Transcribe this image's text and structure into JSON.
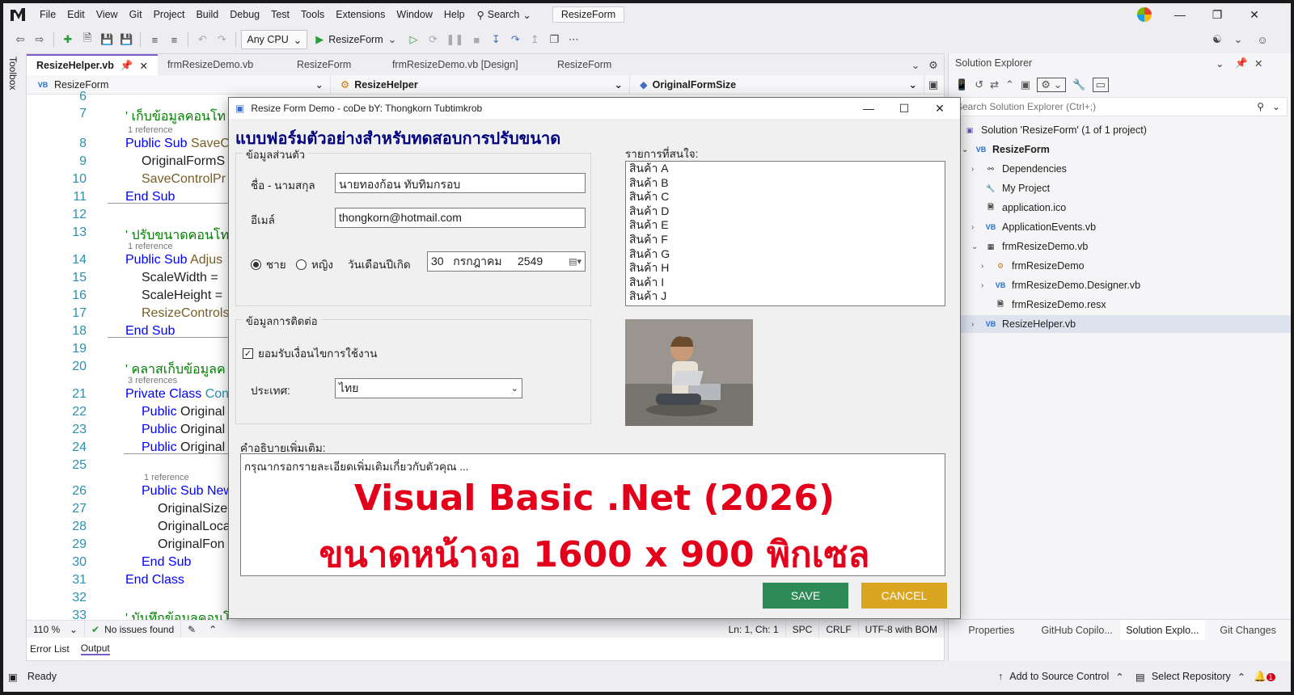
{
  "menubar": {
    "items": [
      "File",
      "Edit",
      "View",
      "Git",
      "Project",
      "Build",
      "Debug",
      "Test",
      "Tools",
      "Extensions",
      "Window",
      "Help"
    ],
    "search_label": "Search",
    "solution_name": "ResizeForm"
  },
  "toolbar": {
    "platform": "Any CPU",
    "run_target": "ResizeForm"
  },
  "toolbox_label": "Toolbox",
  "editor": {
    "tabs": [
      "ResizeHelper.vb",
      "frmResizeDemo.vb",
      "ResizeForm",
      "frmResizeDemo.vb [Design]",
      "ResizeForm"
    ],
    "nav": [
      "ResizeForm",
      "ResizeHelper",
      "OriginalFormSize"
    ],
    "lines": [
      {
        "n": "6",
        "t": ""
      },
      {
        "n": "7",
        "t": "' เก็บข้อมูลคอนโท"
      },
      {
        "n": "8",
        "kw": "Public Sub ",
        "t": "SaveC"
      },
      {
        "n": "9",
        "t": "OriginalFormS"
      },
      {
        "n": "10",
        "t": "SaveControlPr"
      },
      {
        "n": "11",
        "kw": "End Sub",
        "t": ""
      },
      {
        "n": "12",
        "t": ""
      },
      {
        "n": "13",
        "t": "' ปรับขนาดคอนโท"
      },
      {
        "n": "14",
        "kw": "Public Sub ",
        "t": "Adjus"
      },
      {
        "n": "15",
        "t": "ScaleWidth ="
      },
      {
        "n": "16",
        "t": "ScaleHeight ="
      },
      {
        "n": "17",
        "t": "ResizeControls"
      },
      {
        "n": "18",
        "kw": "End Sub",
        "t": ""
      },
      {
        "n": "19",
        "t": ""
      },
      {
        "n": "20",
        "t": "' คลาสเก็บข้อมูลค"
      },
      {
        "n": "21",
        "kw": "Private Class ",
        "t": "Con"
      },
      {
        "n": "22",
        "kw": "Public ",
        "t": "Original"
      },
      {
        "n": "23",
        "kw": "Public ",
        "t": "Original"
      },
      {
        "n": "24",
        "kw": "Public ",
        "t": "Original"
      },
      {
        "n": "25",
        "t": ""
      },
      {
        "n": "26",
        "kw": "Public Sub ",
        "t": "New"
      },
      {
        "n": "27",
        "t": "OriginalSize"
      },
      {
        "n": "28",
        "t": "OriginalLoca"
      },
      {
        "n": "29",
        "t": "OriginalFon"
      },
      {
        "n": "30",
        "kw": "End Sub",
        "t": ""
      },
      {
        "n": "31",
        "kw": "End Class",
        "t": ""
      },
      {
        "n": "32",
        "t": ""
      },
      {
        "n": "33",
        "t": "' บันทึกข้อมูลคอนโ"
      }
    ],
    "refs": [
      "1 reference",
      "1 reference",
      "3 references",
      "1 reference"
    ],
    "zoom": "110 %",
    "issues": "No issues found",
    "position": "Ln: 1, Ch: 1",
    "spc": "SPC",
    "crlf": "CRLF",
    "encoding": "UTF-8 with BOM",
    "bottom_tabs": [
      "Error List",
      "Output"
    ]
  },
  "solution_explorer": {
    "title": "Solution Explorer",
    "search_placeholder": "Search Solution Explorer (Ctrl+;)",
    "tree": [
      "Solution 'ResizeForm' (1 of 1 project)",
      "ResizeForm",
      "Dependencies",
      "My Project",
      "application.ico",
      "ApplicationEvents.vb",
      "frmResizeDemo.vb",
      "frmResizeDemo",
      "frmResizeDemo.Designer.vb",
      "frmResizeDemo.resx",
      "ResizeHelper.vb"
    ],
    "bottom_tabs": [
      "Properties",
      "GitHub Copilo...",
      "Solution Explo...",
      "Git Changes"
    ]
  },
  "statusbar": {
    "ready": "Ready",
    "source_control": "Add to Source Control",
    "repository": "Select Repository",
    "notifications": "1"
  },
  "form": {
    "title": "Resize Form Demo - coDe bY: Thongkorn Tubtimkrob",
    "heading": "แบบฟอร์มตัวอย่างสำหรับทดสอบการปรับขนาด",
    "group_personal": "ข้อมูลส่วนตัว",
    "name_label": "ชื่อ - นามสกุล",
    "name_value": "นายทองก้อน ทับทิมกรอบ",
    "email_label": "อีเมล์",
    "email_value": "thongkorn@hotmail.com",
    "radio_male": "ชาย",
    "radio_female": "หญิง",
    "birthdate_label": "วันเดือนปีเกิด",
    "birthdate_value": "30   กรกฎาคม     2549",
    "group_contact": "ข้อมูลการติดต่อ",
    "accept_label": "ยอมรับเงื่อนไขการใช้งาน",
    "country_label": "ประเทศ:",
    "country_value": "ไทย",
    "interests_label": "รายการที่สนใจ:",
    "interests": [
      "สินค้า A",
      "สินค้า B",
      "สินค้า C",
      "สินค้า D",
      "สินค้า E",
      "สินค้า F",
      "สินค้า G",
      "สินค้า H",
      "สินค้า I",
      "สินค้า J"
    ],
    "notes_label": "คำอธิบายเพิ่มเติม:",
    "notes_value": "กรุณากรอกรายละเอียดเพิ่มเติมเกี่ยวกับตัวคุณ ...",
    "overlay_line1": "Visual Basic .Net (2026)",
    "overlay_line2": "ขนาดหน้าจอ 1600 x 900 พิกเซล",
    "save_label": "SAVE",
    "cancel_label": "CANCEL"
  },
  "colors": {
    "save": "#2e8b57",
    "cancel": "#daa520",
    "overlay": "#e3001b",
    "heading": "#000080"
  }
}
